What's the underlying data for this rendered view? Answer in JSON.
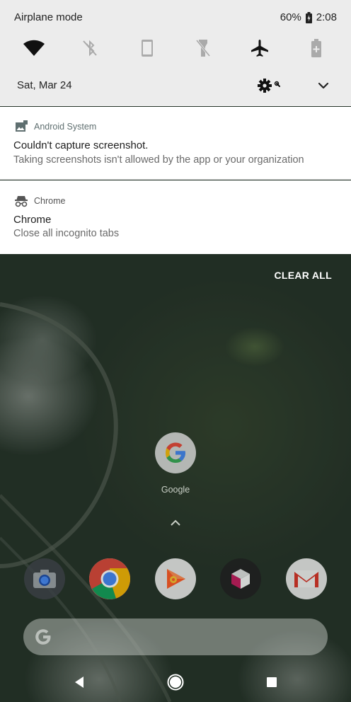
{
  "status_bar": {
    "mode_label": "Airplane mode",
    "battery_percent": "60%",
    "time": "2:08"
  },
  "quick_settings": {
    "tiles": [
      {
        "icon": "wifi-icon",
        "state": "on"
      },
      {
        "icon": "bluetooth-off-icon",
        "state": "off"
      },
      {
        "icon": "auto-rotate-icon",
        "state": "off"
      },
      {
        "icon": "flashlight-off-icon",
        "state": "off"
      },
      {
        "icon": "airplane-icon",
        "state": "on"
      },
      {
        "icon": "battery-saver-icon",
        "state": "off"
      }
    ],
    "date": "Sat, Mar 24"
  },
  "notifications": [
    {
      "app": "Android System",
      "icon": "screenshot-icon",
      "title": "Couldn't capture screenshot.",
      "text": "Taking screenshots isn't allowed by the app or your organization"
    },
    {
      "app": "Chrome",
      "icon": "incognito-icon",
      "title": "Chrome",
      "text": "Close all incognito tabs"
    }
  ],
  "clear_all_label": "CLEAR ALL",
  "home": {
    "folder_label": "Google",
    "dock": [
      "camera-icon",
      "chrome-icon",
      "play-music-icon",
      "cube-icon",
      "gmail-icon"
    ]
  },
  "colors": {
    "shade_bg": "#ececec",
    "notification_bg": "#ffffff",
    "android_system_accent": "#5f6f70"
  }
}
